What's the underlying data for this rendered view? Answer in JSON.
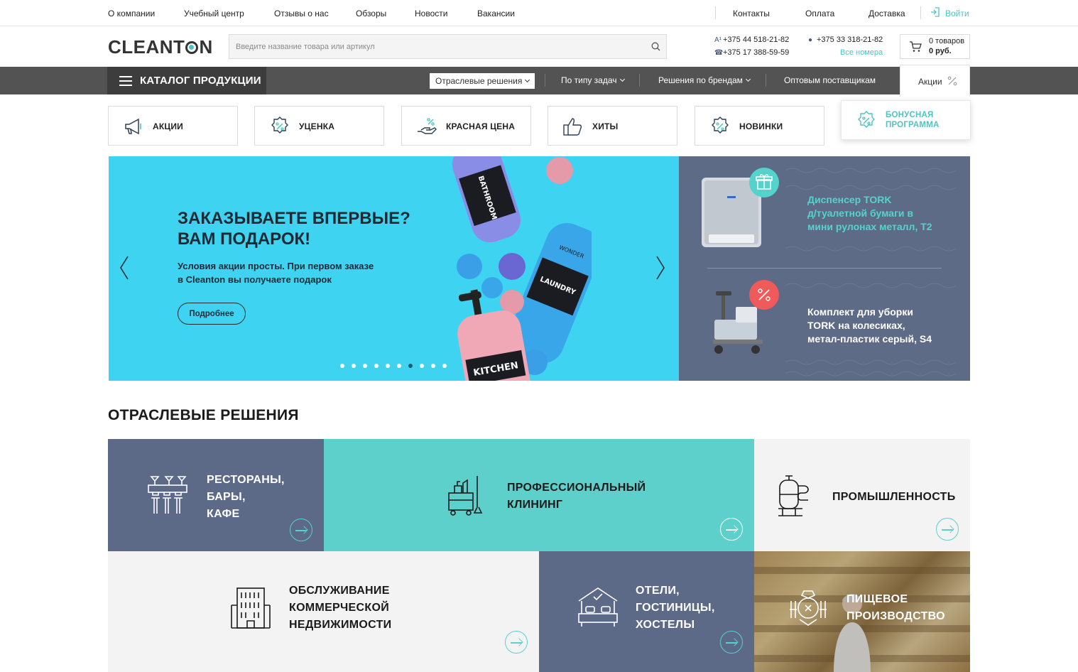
{
  "topnav": {
    "left": [
      "О компании",
      "Учебный центр",
      "Отзывы о нас",
      "Обзоры",
      "Новости",
      "Вакансии"
    ],
    "right": [
      "Контакты",
      "Оплата",
      "Доставка"
    ],
    "login": "Войти"
  },
  "header": {
    "logo_text": "CLEANT",
    "logo_tail": "N",
    "search_placeholder": "Введите название товара или артикул",
    "phones": [
      "+375 44 518-21-82",
      "+375 17 388-59-59",
      "+375 33 318-21-82"
    ],
    "all_numbers": "Все номера",
    "cart": {
      "items": "0 товаров",
      "sum": "0 руб."
    }
  },
  "catalog_bar": {
    "catalog_label": "КАТАЛОГ ПРОДУКЦИИ",
    "items": [
      "Отраслевые решения",
      "По типу задач",
      "Решения по брендам",
      "Оптовым поставщикам"
    ],
    "promo_tab": "Акции",
    "promo_icon": "percent-icon"
  },
  "quick_tiles": [
    {
      "label": "АКЦИИ",
      "icon": "megaphone-icon"
    },
    {
      "label": "УЦЕНКА",
      "icon": "discount-badge-icon"
    },
    {
      "label": "КРАСНАЯ ЦЕНА",
      "icon": "hand-percent-icon"
    },
    {
      "label": "ХИТЫ",
      "icon": "thumbs-up-icon"
    },
    {
      "label": "НОВИНКИ",
      "icon": "discount-badge-icon"
    }
  ],
  "bonus": {
    "line1": "БОНУСНАЯ",
    "line2": "ПРОГРАММА",
    "icon": "discount-badge-icon"
  },
  "hero": {
    "title_line1": "ЗАКАЗЫВАЕТЕ ВПЕРВЫЕ?",
    "title_line2": "ВАМ ПОДАРОК!",
    "text_line1": "Условия акции просты. При первом заказе",
    "text_line2": "в Cleanton вы получаете подарок",
    "button": "Подробнее",
    "dots_total": 10,
    "active_dot": 7,
    "bottle_labels": [
      "BATHROOM",
      "LAUNDRY",
      "KITCHEN",
      "WONDER"
    ]
  },
  "side_promos": [
    {
      "line1": "Диспенсер TORK",
      "line2": "д/туалетной бумаги в",
      "line3": "мини рулонах металл, T2",
      "badge": "gift-icon"
    },
    {
      "line1": "Комплект для уборки",
      "line2": "TORK на колесиках,",
      "line3": "метал-пластик серый, S4",
      "badge": "percent-icon"
    }
  ],
  "section_title": "ОТРАСЛЕВЫЕ РЕШЕНИЯ",
  "industries": [
    {
      "lines": [
        "РЕСТОРАНЫ,",
        "БАРЫ,",
        "КАФЕ"
      ],
      "icon": "restaurant-icon"
    },
    {
      "lines": [
        "ПРОФЕССИОНАЛЬНЫЙ",
        "КЛИНИНГ"
      ],
      "icon": "cleaning-cart-icon"
    },
    {
      "lines": [
        "ПРОМЫШЛЕННОСТЬ"
      ],
      "icon": "industry-tank-icon"
    },
    {
      "lines": [
        "ОБСЛУЖИВАНИЕ",
        "КОММЕРЧЕСКОЙ",
        "НЕДВИЖИМОСТИ"
      ],
      "icon": "building-icon"
    },
    {
      "lines": [
        "ОТЕЛИ,",
        "ГОСТИНИЦЫ,",
        "ХОСТЕЛЫ"
      ],
      "icon": "hotel-bed-icon"
    },
    {
      "lines": [
        "ПИЩЕВОЕ",
        "ПРОИЗВОДСТВО"
      ],
      "icon": "food-production-icon"
    }
  ],
  "colors": {
    "accent": "#4ec4c0",
    "dark_slate": "#5c6987",
    "catalog_bar": "#535353",
    "hero_bg": "#3fd3f2"
  }
}
